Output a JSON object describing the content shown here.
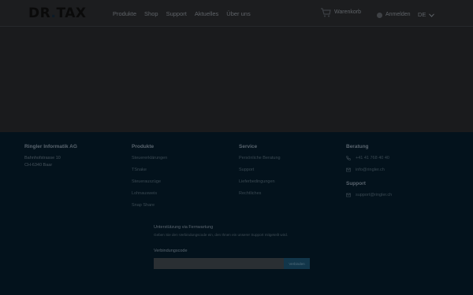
{
  "header": {
    "logo": {
      "part1": "DR",
      "dot": ".",
      "part2": "TAX"
    },
    "nav": [
      "Produkte",
      "Shop",
      "Support",
      "Aktuelles",
      "Über uns"
    ],
    "cart_label": "Warenkorb",
    "login_label": "Anmelden",
    "language": "DE"
  },
  "footer": {
    "company": {
      "name": "Ringler Informatik AG",
      "street": "Bahnhofstrasse 10",
      "city": "CH-6340 Baar"
    },
    "produkte": {
      "title": "Produkte",
      "items": [
        "Steuererklärungen",
        "TSnake",
        "Steuerauszüge",
        "Lohnausweis",
        "Snap Share"
      ]
    },
    "service": {
      "title": "Service",
      "items": [
        "Persönliche Beratung",
        "Support",
        "Lieferbedingungen",
        "Rechtliches"
      ]
    },
    "beratung": {
      "title": "Beratung",
      "phone": "+41 41 768 40 40",
      "email": "info@ringler.ch"
    },
    "support": {
      "title": "Support",
      "email": "support@ringler.ch"
    },
    "remote": {
      "title": "Unterstützung via Fernwartung",
      "description": "Geben Sie den Verbindungscode ein, den Ihnen ein unserer Support mitgeteilt wird.",
      "code_label": "Verbindungscode",
      "button_label": "Verbinden"
    }
  },
  "colors": {
    "header_bg": "#1c1d1f",
    "content_bg": "#1a1b1d",
    "footer_bg": "#03121c",
    "button_bg": "#12364a"
  }
}
